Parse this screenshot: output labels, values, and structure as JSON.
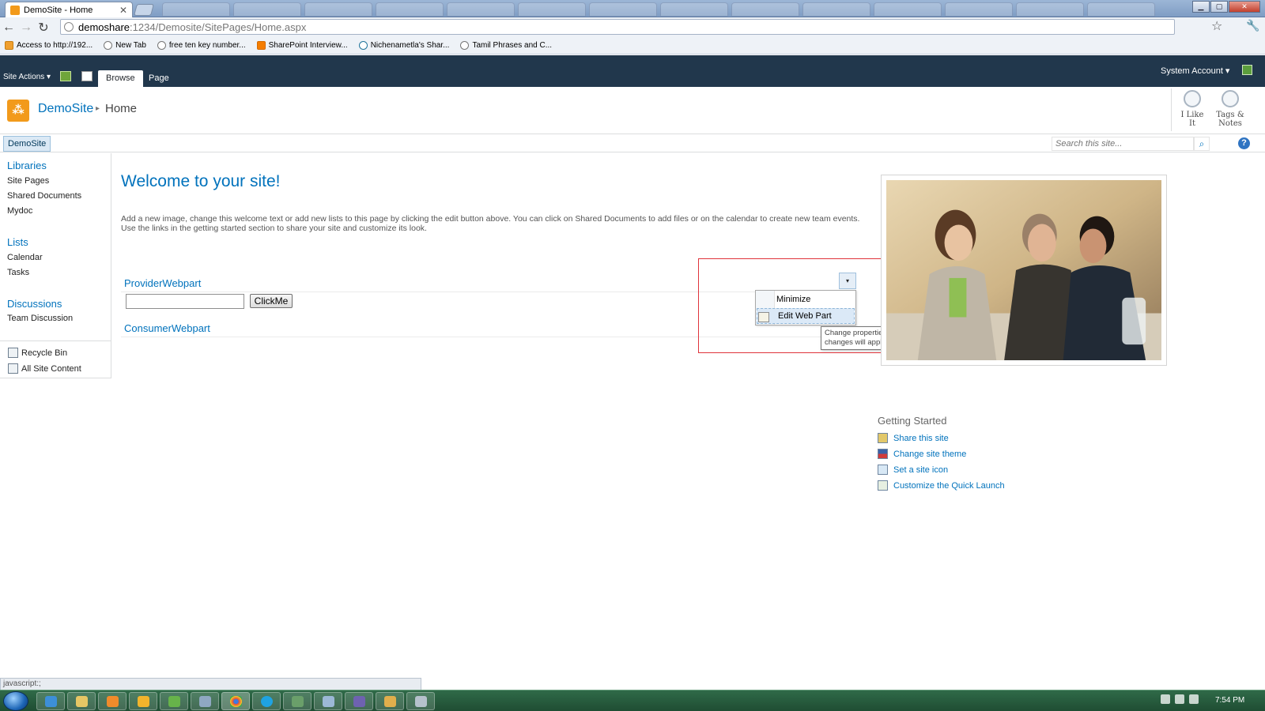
{
  "browser": {
    "tab_title": "DemoSite - Home",
    "tab_close": "✕",
    "url_host": "demoshare",
    "url_path": ":1234/Demosite/SitePages/Home.aspx",
    "bookmarks": [
      {
        "label": "Access to http://192...",
        "icon": "folder-icon"
      },
      {
        "label": "New Tab",
        "icon": "globe-icon"
      },
      {
        "label": "free ten key number...",
        "icon": "globe-icon"
      },
      {
        "label": "SharePoint Interview...",
        "icon": "blogger-icon"
      },
      {
        "label": "Nichenametla's Shar...",
        "icon": "wordpress-icon"
      },
      {
        "label": "Tamil Phrases and C...",
        "icon": "globe-icon"
      }
    ],
    "status_text": "javascript:;"
  },
  "ribbon": {
    "site_actions": "Site Actions ▾",
    "tabs": [
      "Browse",
      "Page"
    ],
    "user": "System Account ▾"
  },
  "title_area": {
    "site_name": "DemoSite",
    "separator": "▸",
    "page_name": "Home",
    "like_label": "I Like It",
    "tags_label_1": "Tags &",
    "tags_label_2": "Notes"
  },
  "top_nav": {
    "site_tab": "DemoSite",
    "search_placeholder": "Search this site...",
    "search_glyph": "⌕",
    "help_glyph": "?"
  },
  "quick_launch": {
    "libraries_heading": "Libraries",
    "libraries": [
      "Site Pages",
      "Shared Documents",
      "Mydoc"
    ],
    "lists_heading": "Lists",
    "lists": [
      "Calendar",
      "Tasks"
    ],
    "discussions_heading": "Discussions",
    "discussions": [
      "Team Discussion"
    ],
    "recycle_bin": "Recycle Bin",
    "all_site_content": "All Site Content"
  },
  "main": {
    "welcome_title": "Welcome to your site!",
    "welcome_text": "Add a new image, change this welcome text or add new lists to this page by clicking the edit button above. You can click on Shared Documents to add files or on the calendar to create new team events. Use the links in the getting started section to share your site and customize its look.",
    "provider_title": "ProviderWebpart",
    "provider_input_value": "",
    "provider_button": "ClickMe",
    "consumer_title": "ConsumerWebpart",
    "menu_arrow": "▾",
    "webpart_menu": [
      "Minimize",
      "Edit Web Part"
    ],
    "tooltip": "Change properties of this shared Web Part. These changes will apply to all users."
  },
  "getting_started": {
    "heading": "Getting Started",
    "links": [
      "Share this site",
      "Change site theme",
      "Set a site icon",
      "Customize the Quick Launch"
    ]
  },
  "taskbar": {
    "clock": "7:54 PM"
  },
  "colors": {
    "sp_link_blue": "#0072bc",
    "ribbon_dark": "#21374c",
    "highlight_red": "#e0343b",
    "logo_orange": "#f29a1b"
  }
}
